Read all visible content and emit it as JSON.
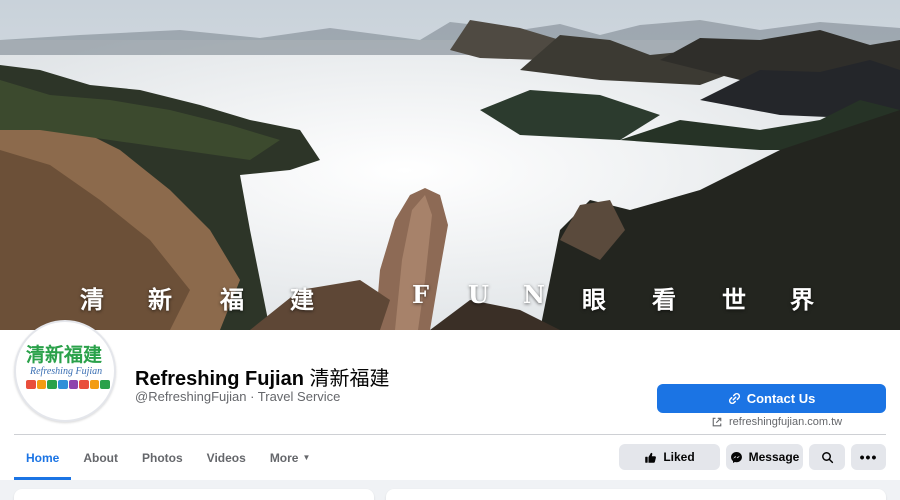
{
  "cover": {
    "caption_chars": [
      "清",
      "新",
      "福",
      "建",
      "F",
      "U",
      "N",
      "眼",
      "看",
      "世",
      "界"
    ]
  },
  "avatar": {
    "logo_cn": "清新福建",
    "logo_en": "Refreshing Fujian",
    "logo_colors": [
      "#e94e3c",
      "#f39c12",
      "#2aa14a",
      "#2f8fd8",
      "#8e44ad",
      "#e94e3c",
      "#f39c12",
      "#2aa14a"
    ]
  },
  "page": {
    "name_en": "Refreshing Fujian",
    "name_cn": "清新福建",
    "handle_category": "@RefreshingFujian · Travel Service"
  },
  "contact": {
    "label": "Contact Us",
    "website": "refreshingfujian.com.tw",
    "icon": "link-icon"
  },
  "tabs": [
    {
      "label": "Home",
      "active": true
    },
    {
      "label": "About",
      "active": false
    },
    {
      "label": "Photos",
      "active": false
    },
    {
      "label": "Videos",
      "active": false
    },
    {
      "label": "More",
      "active": false
    }
  ],
  "actions": {
    "liked": "Liked",
    "message": "Message"
  },
  "colors": {
    "accent": "#1b74e4",
    "button_gray": "#e4e6eb",
    "text_secondary": "#65676b"
  }
}
